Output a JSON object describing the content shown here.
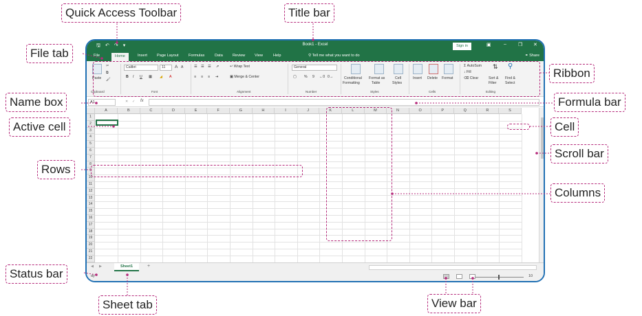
{
  "window": {
    "title": "Book1 - Excel",
    "sign_in": "Sign in",
    "share": "Share",
    "qat_icons": [
      "save-icon",
      "undo-icon",
      "redo-icon",
      "customize-icon"
    ]
  },
  "tabs": [
    "File",
    "Home",
    "Insert",
    "Page Layout",
    "Formulas",
    "Data",
    "Review",
    "View",
    "Help"
  ],
  "tell_me": "Tell me what you want to do",
  "ribbon": {
    "clipboard": {
      "paste": "Paste",
      "label": "Clipboard"
    },
    "font": {
      "name": "Calibri",
      "size": "11",
      "bold": "B",
      "italic": "I",
      "underline": "U",
      "grow": "A",
      "shrink": "A",
      "label": "Font"
    },
    "alignment": {
      "wrap": "Wrap Text",
      "merge": "Merge & Center",
      "label": "Alignment"
    },
    "number": {
      "format": "General",
      "percent": "%",
      "comma": "9",
      "label": "Number"
    },
    "styles": {
      "conditional": "Conditional",
      "conditional2": "Formatting",
      "format_as": "Format as",
      "format_as2": "Table",
      "cell": "Cell",
      "cell2": "Styles",
      "label": "Styles"
    },
    "cells": {
      "insert": "Insert",
      "delete": "Delete",
      "format": "Format",
      "label": "Cells"
    },
    "editing": {
      "autosum": "AutoSum",
      "fill": "Fill",
      "clear": "Clear",
      "sort": "Sort &",
      "sort2": "Filter",
      "find": "Find &",
      "find2": "Select",
      "label": "Editing"
    }
  },
  "formula_bar": {
    "name_box": "A1",
    "fx": "fx"
  },
  "columns": [
    "A",
    "B",
    "C",
    "D",
    "E",
    "F",
    "G",
    "H",
    "I",
    "J",
    "K",
    "L",
    "M",
    "N",
    "O",
    "P",
    "Q",
    "R",
    "S"
  ],
  "rows": [
    "1",
    "2",
    "3",
    "4",
    "5",
    "6",
    "7",
    "8",
    "9",
    "10",
    "11",
    "12",
    "13",
    "14",
    "15",
    "16",
    "17",
    "18",
    "19",
    "20",
    "21",
    "22"
  ],
  "sheet": {
    "tab": "Sheet1",
    "add": "+"
  },
  "status": {
    "ready": "dy",
    "zoom": "10"
  },
  "callouts": {
    "quick_access": "Quick Access Toolbar",
    "title_bar": "Title bar",
    "file_tab": "File tab",
    "ribbon": "Ribbon",
    "name_box": "Name box",
    "formula_bar": "Formula bar",
    "active_cell": "Active cell",
    "cell": "Cell",
    "scroll_bar": "Scroll bar",
    "rows": "Rows",
    "columns": "Columns",
    "status_bar": "Status bar",
    "sheet_tab": "Sheet tab",
    "view_bar": "View bar"
  },
  "colors": {
    "excel_green": "#217346",
    "callout_border": "#b5297a",
    "window_border": "#1f6fb3"
  }
}
